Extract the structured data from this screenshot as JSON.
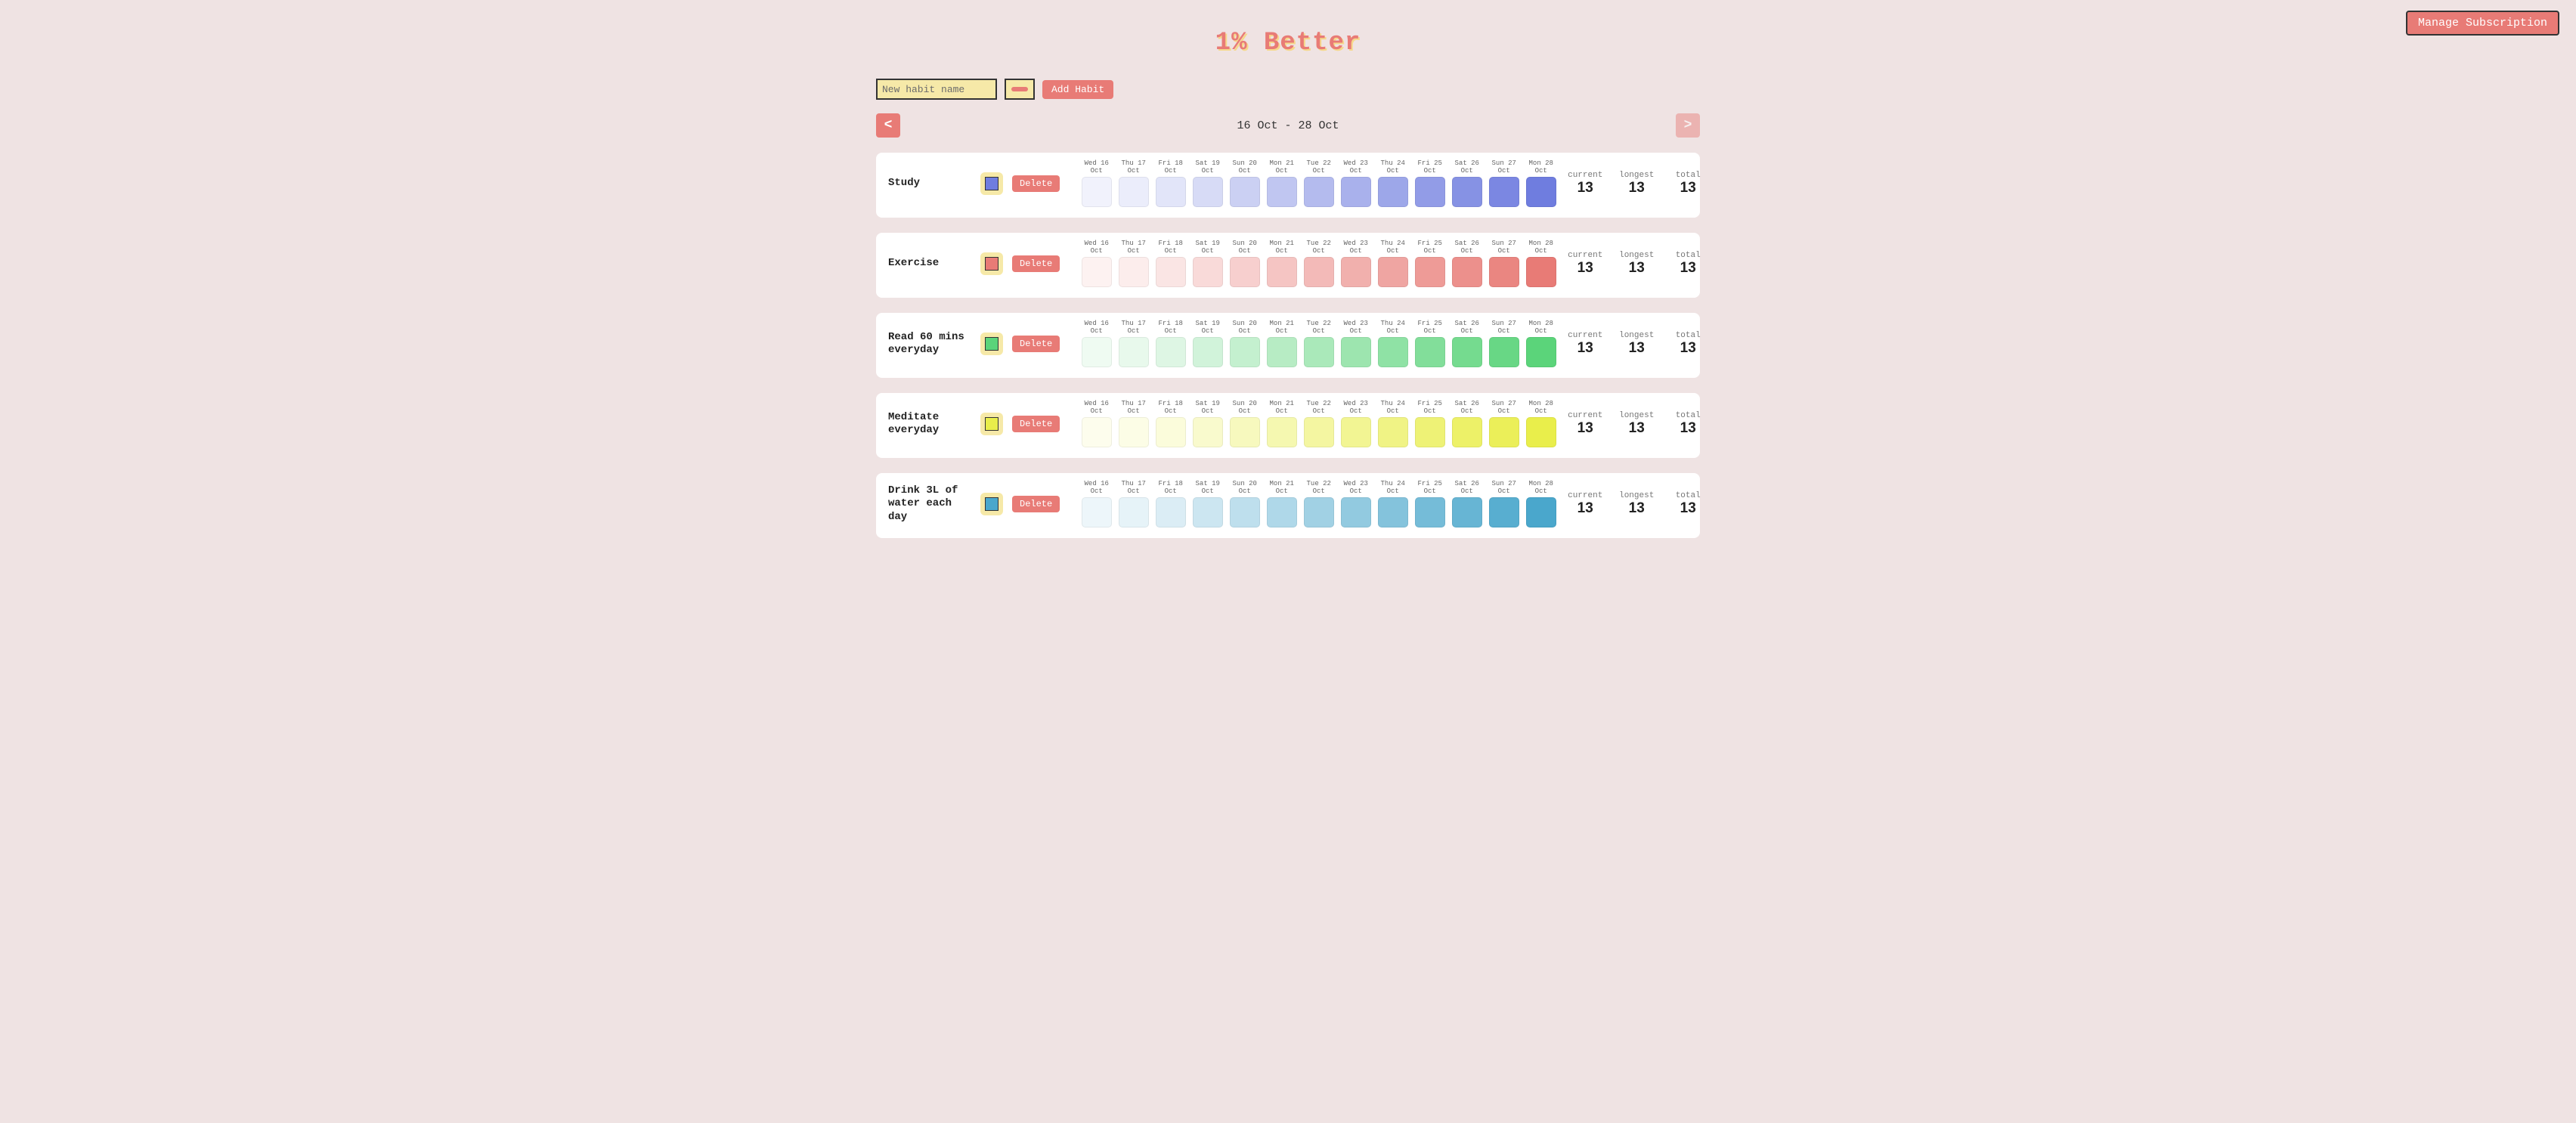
{
  "page_title": "1% Better",
  "manage_subscription_label": "Manage Subscription",
  "new_habit_placeholder": "New habit name",
  "add_habit_label": "Add Habit",
  "new_habit_preview_color": "#e87b76",
  "prev_label": "<",
  "next_label": ">",
  "date_range_label": "16 Oct - 28 Oct",
  "delete_label": "Delete",
  "day_headers": [
    "Wed 16 Oct",
    "Thu 17 Oct",
    "Fri 18 Oct",
    "Sat 19 Oct",
    "Sun 20 Oct",
    "Mon 21 Oct",
    "Tue 22 Oct",
    "Wed 23 Oct",
    "Thu 24 Oct",
    "Fri 25 Oct",
    "Sat 26 Oct",
    "Sun 27 Oct",
    "Mon 28 Oct"
  ],
  "stats_labels": {
    "current": "current",
    "longest": "longest",
    "total": "total"
  },
  "shade_alphas": [
    0.1,
    0.14,
    0.2,
    0.28,
    0.36,
    0.44,
    0.52,
    0.6,
    0.68,
    0.76,
    0.84,
    0.92,
    1.0
  ],
  "habits": [
    {
      "name": "Study",
      "color": "#6f7ddf",
      "current": 13,
      "longest": 13,
      "total": 13
    },
    {
      "name": "Exercise",
      "color": "#e87b76",
      "current": 13,
      "longest": 13,
      "total": 13
    },
    {
      "name": "Read 60 mins everyday",
      "color": "#5bd47a",
      "current": 13,
      "longest": 13,
      "total": 13
    },
    {
      "name": "Meditate everyday",
      "color": "#e9ee4b",
      "current": 13,
      "longest": 13,
      "total": 13
    },
    {
      "name": "Drink 3L of water each day",
      "color": "#4aa7cc",
      "current": 13,
      "longest": 13,
      "total": 13
    }
  ]
}
